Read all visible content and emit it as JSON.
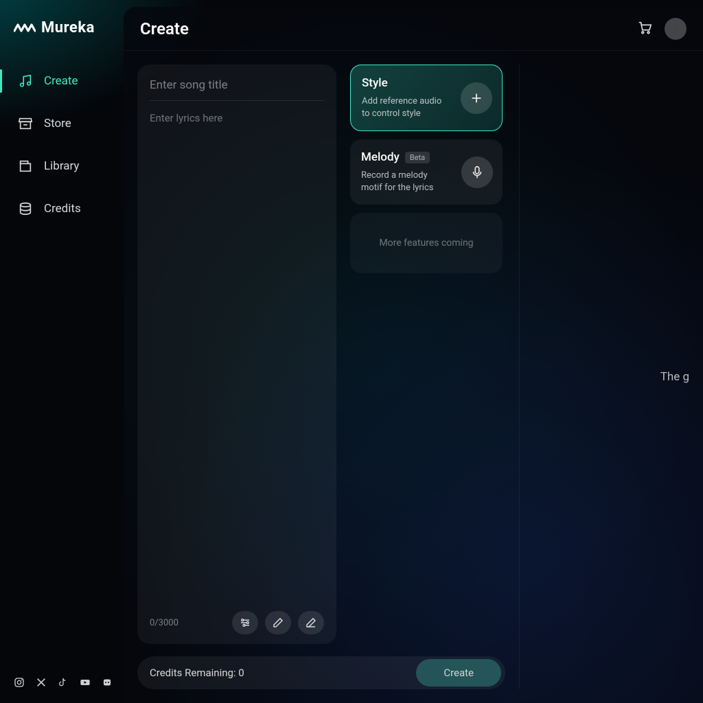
{
  "brand": {
    "name": "Mureka"
  },
  "sidebar": {
    "items": [
      {
        "label": "Create",
        "icon": "music-note-icon",
        "active": true
      },
      {
        "label": "Store",
        "icon": "store-icon",
        "active": false
      },
      {
        "label": "Library",
        "icon": "library-icon",
        "active": false
      },
      {
        "label": "Credits",
        "icon": "credits-icon",
        "active": false
      }
    ],
    "social": [
      "instagram",
      "x",
      "tiktok",
      "youtube",
      "discord"
    ]
  },
  "header": {
    "title": "Create"
  },
  "editor": {
    "title_placeholder": "Enter song title",
    "title_value": "",
    "lyrics_placeholder": "Enter lyrics here",
    "lyrics_value": "",
    "charcount": "0/3000"
  },
  "cards": {
    "style": {
      "title": "Style",
      "desc": "Add reference audio to control style"
    },
    "melody": {
      "title": "Melody",
      "badge": "Beta",
      "desc": "Record a melody motif for the lyrics"
    },
    "placeholder": "More features coming"
  },
  "footer": {
    "credits_label": "Credits Remaining: 0",
    "create_button": "Create"
  },
  "preview": {
    "text": "The g"
  },
  "colors": {
    "accent": "#3de9c3"
  }
}
